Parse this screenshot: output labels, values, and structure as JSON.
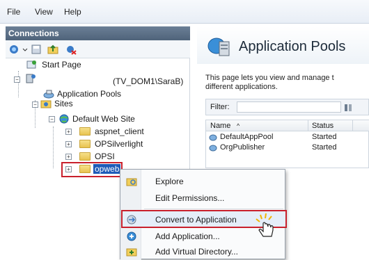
{
  "menubar": {
    "items": [
      "File",
      "View",
      "Help"
    ]
  },
  "connections": {
    "header": "Connections",
    "toolbar_icons": [
      "connect-icon",
      "save-icon",
      "folder-up-icon",
      "disconnect-icon"
    ],
    "tree": {
      "start_page": "Start Page",
      "server": "(TV_DOM1\\SaraB)",
      "app_pools": "Application Pools",
      "sites": "Sites",
      "default_site": "Default Web Site",
      "children": [
        "aspnet_client",
        "OPSilverlight",
        "OPSI",
        "opweb"
      ]
    }
  },
  "main": {
    "title": "Application Pools",
    "description_line1": "This page lets you view and manage t",
    "description_line2": "different applications.",
    "filter_label": "Filter:",
    "columns": [
      "Name",
      "Status"
    ],
    "rows": [
      {
        "name": "DefaultAppPool",
        "status": "Started"
      },
      {
        "name": "OrgPublisher",
        "status": "Started"
      }
    ]
  },
  "context_menu": {
    "items": [
      "Explore",
      "Edit Permissions...",
      "Convert to Application",
      "Add Application...",
      "Add Virtual Directory..."
    ],
    "icons": [
      "explore-icon",
      "",
      "convert-app-icon",
      "add-app-icon",
      "add-vdir-icon"
    ]
  },
  "colors": {
    "selection": "#1e5bb8",
    "highlight_box": "#c8202c",
    "header_bg": "#4f637a"
  }
}
